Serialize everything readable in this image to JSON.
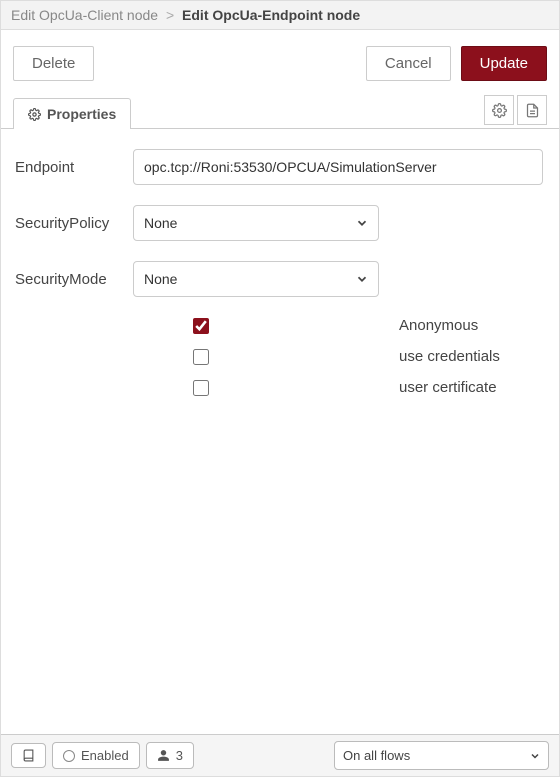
{
  "breadcrumb": {
    "prev": "Edit OpcUa-Client node",
    "current": "Edit OpcUa-Endpoint node"
  },
  "buttons": {
    "delete": "Delete",
    "cancel": "Cancel",
    "update": "Update"
  },
  "tabs": {
    "properties": "Properties"
  },
  "form": {
    "endpoint_label": "Endpoint",
    "endpoint_value": "opc.tcp://Roni:53530/OPCUA/SimulationServer",
    "security_policy_label": "SecurityPolicy",
    "security_policy_value": "None",
    "security_mode_label": "SecurityMode",
    "security_mode_value": "None",
    "auth": {
      "anonymous": "Anonymous",
      "use_credentials": "use credentials",
      "user_certificate": "user certificate"
    }
  },
  "footer": {
    "enabled": "Enabled",
    "user_count": "3",
    "scope": "On all flows"
  }
}
